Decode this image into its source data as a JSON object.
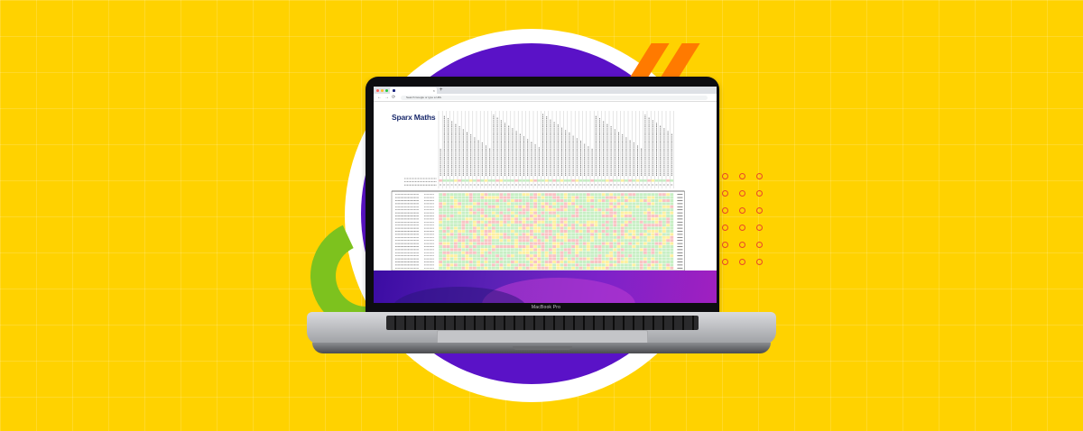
{
  "background": {
    "color": "#FFD200",
    "accent_purple": "#5A12C7",
    "accent_green": "#7DC21E",
    "accent_orange": "#FF7A00"
  },
  "laptop": {
    "brand": "MacBook Pro"
  },
  "browser": {
    "tab_icon": "sparx-favicon-icon",
    "tab_close": "×",
    "new_tab": "+",
    "nav": {
      "back": "←",
      "forward": "→",
      "reload": "⟳"
    },
    "address_placeholder": "Search Google or type a URL"
  },
  "sheet": {
    "logo": "Sparx Maths",
    "colors": {
      "green": "#c7efc4",
      "red": "#f8c3c3",
      "yellow": "#fdf0a0"
    },
    "question_count": 62,
    "student_count": 25
  }
}
